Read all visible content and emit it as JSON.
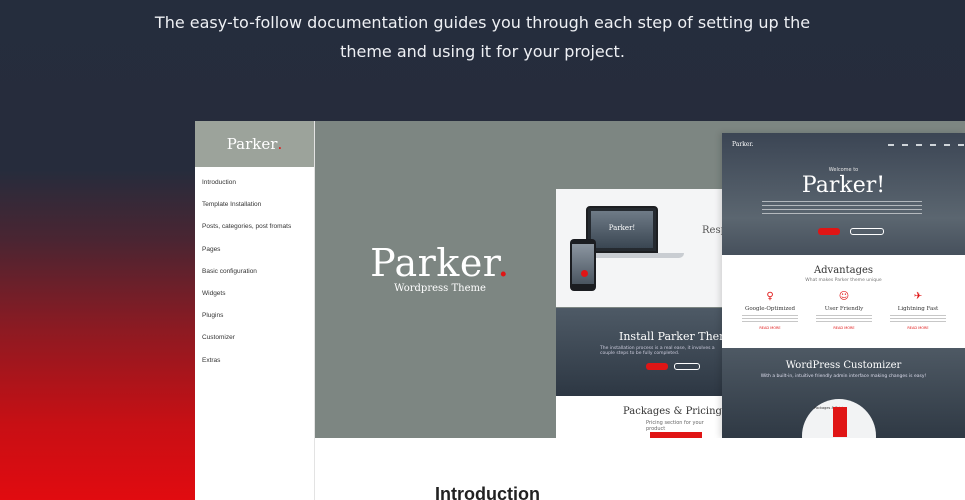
{
  "hero": {
    "line1": "The easy-to-follow documentation guides you through each step of setting up the",
    "line2": "theme and using it for your project."
  },
  "sidebar": {
    "logo": "Parker",
    "logo_dot": ".",
    "items": [
      {
        "label": "Introduction"
      },
      {
        "label": "Template Installation"
      },
      {
        "label": "Posts, categories, post fromats"
      },
      {
        "label": "Pages"
      },
      {
        "label": "Basic configuration"
      },
      {
        "label": "Widgets"
      },
      {
        "label": "Plugins"
      },
      {
        "label": "Customizer"
      },
      {
        "label": "Extras"
      }
    ]
  },
  "banner": {
    "title": "Parker",
    "title_dot": ".",
    "subtitle": "Wordpress Theme"
  },
  "preview": {
    "responsive_title": "Resp",
    "laptop_text": "Parker!",
    "install_title": "Install Parker Theme N",
    "install_desc": "The installation process is a real ease, it involves a couple steps to be fully completed.",
    "packages_title": "Packages & Pricing Tab",
    "packages_sub": "Pricing section for your product",
    "home_logo": "Parker.",
    "welcome": "Welcome to",
    "home_title": "Parker!",
    "advantages_title": "Advantages",
    "advantages_sub": "What makes Parker theme unique",
    "features": [
      {
        "icon": "lightbulb-icon",
        "glyph": "♀",
        "name": "Google-Optimized"
      },
      {
        "icon": "user-icon",
        "glyph": "☺",
        "name": "User Friendly"
      },
      {
        "icon": "rocket-icon",
        "glyph": "✈",
        "name": "Lightning Fast"
      }
    ],
    "read_more": "READ MORE",
    "customizer_title": "WordPress Customizer",
    "customizer_sub": "With a built-in, intuitive friendly admin interface making changes is easy!",
    "packages_small": "Packages & Pricing"
  },
  "content": {
    "heading": "Introduction"
  },
  "colors": {
    "accent": "#e01515",
    "sidebar_header": "#9ca39b",
    "banner": "#7d8682"
  }
}
